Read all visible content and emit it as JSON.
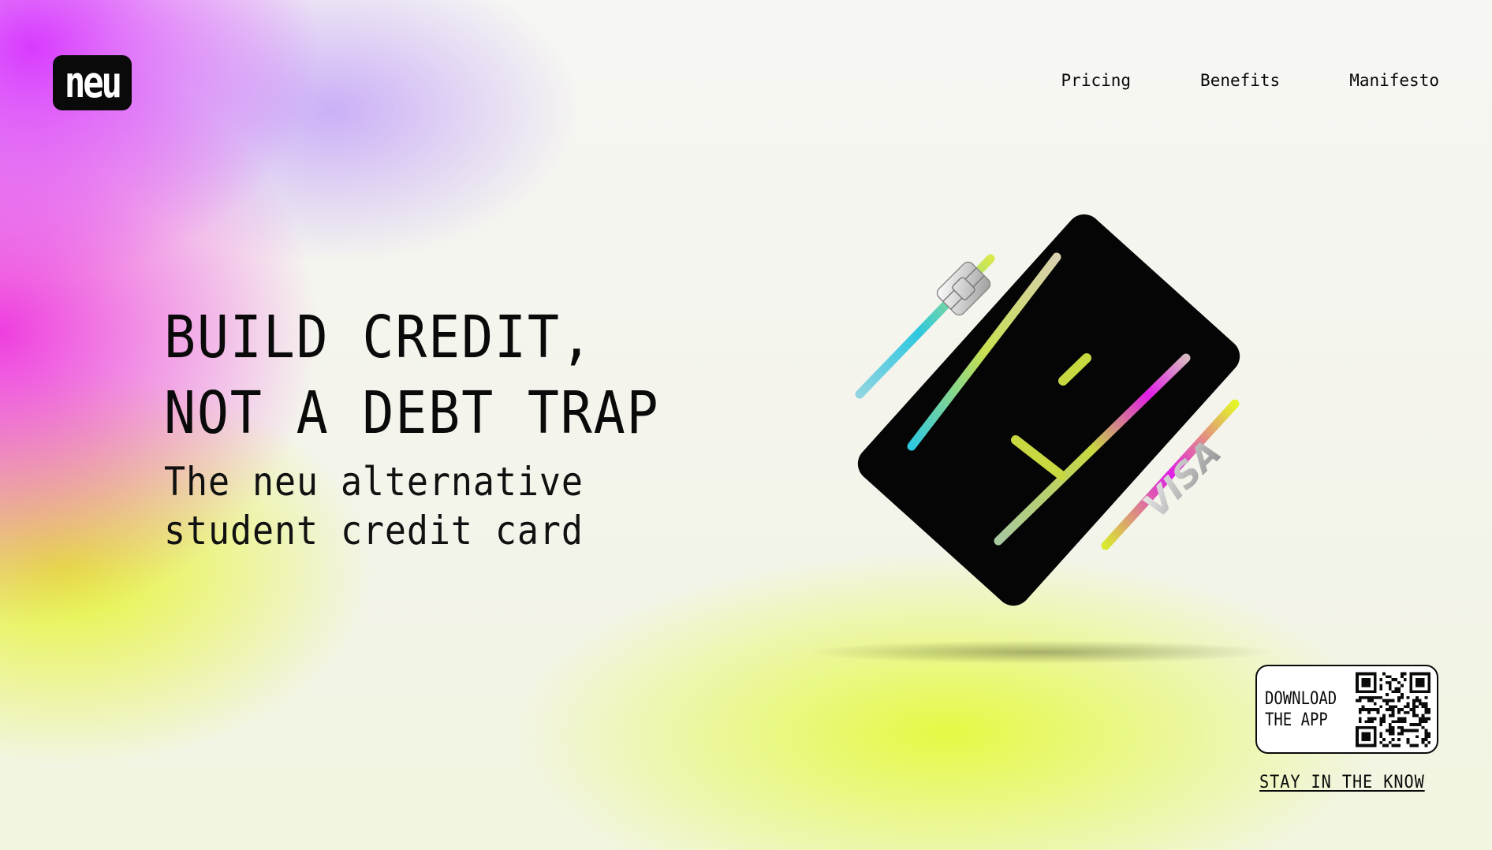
{
  "brand": {
    "logo_text": "neu"
  },
  "nav": {
    "items": [
      {
        "label": "Pricing"
      },
      {
        "label": "Benefits"
      },
      {
        "label": "Manifesto"
      }
    ]
  },
  "hero": {
    "headline_line1": "BUILD CREDIT,",
    "headline_line2": "NOT A DEBT TRAP",
    "subhead_line1": "The neu alternative",
    "subhead_line2": "student credit card"
  },
  "card": {
    "network_text": "VISA"
  },
  "download": {
    "line1": "DOWNLOAD",
    "line2": "THE APP"
  },
  "newsletter": {
    "link_label": "STAY IN THE KNOW"
  },
  "colors": {
    "black": "#0a0a0a",
    "magenta": "#e01ee6",
    "lime": "#e4f528",
    "cyan": "#2ec8e0"
  }
}
